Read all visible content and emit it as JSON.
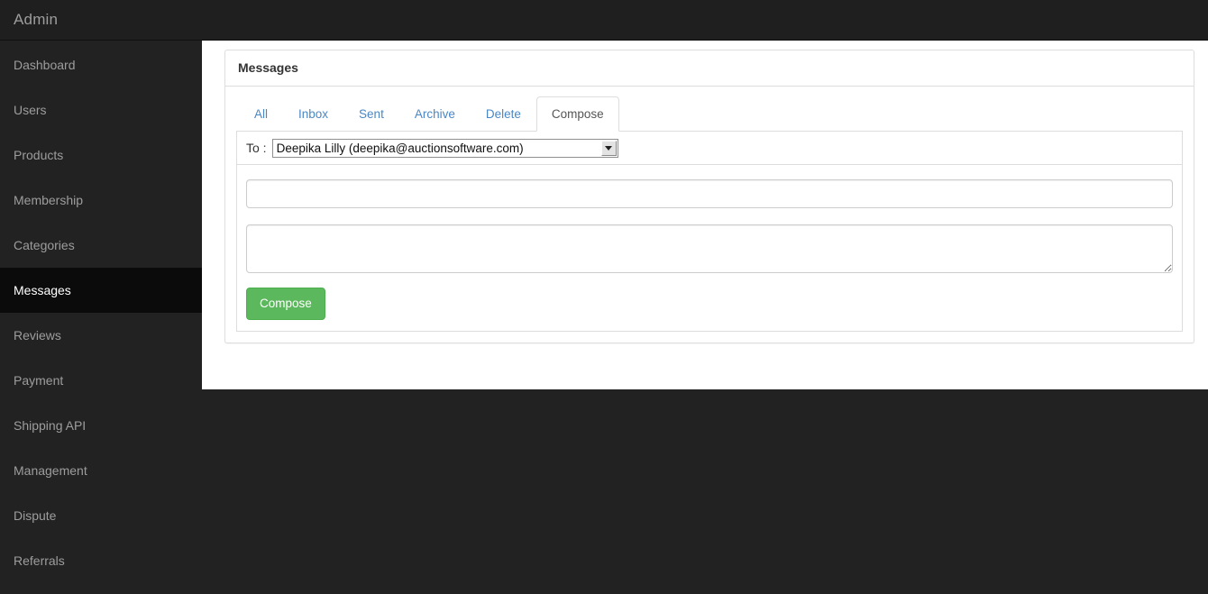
{
  "topbar": {
    "brand": "Admin"
  },
  "sidebar": {
    "items": [
      {
        "label": "Dashboard",
        "active": false
      },
      {
        "label": "Users",
        "active": false
      },
      {
        "label": "Products",
        "active": false
      },
      {
        "label": "Membership",
        "active": false
      },
      {
        "label": "Categories",
        "active": false
      },
      {
        "label": "Messages",
        "active": true
      },
      {
        "label": "Reviews",
        "active": false
      },
      {
        "label": "Payment",
        "active": false
      },
      {
        "label": "Shipping API",
        "active": false
      },
      {
        "label": "Management",
        "active": false
      },
      {
        "label": "Dispute",
        "active": false
      },
      {
        "label": "Referrals",
        "active": false
      }
    ]
  },
  "panel": {
    "title": "Messages"
  },
  "tabs": [
    {
      "label": "All",
      "active": false
    },
    {
      "label": "Inbox",
      "active": false
    },
    {
      "label": "Sent",
      "active": false
    },
    {
      "label": "Archive",
      "active": false
    },
    {
      "label": "Delete",
      "active": false
    },
    {
      "label": "Compose",
      "active": true
    }
  ],
  "compose_form": {
    "to_label": "To :",
    "recipient_selected": "Deepika Lilly (deepika@auctionsoftware.com)",
    "recipient_options": [
      "Deepika Lilly (deepika@auctionsoftware.com)"
    ],
    "subject_value": "",
    "subject_placeholder": "",
    "message_value": "",
    "message_placeholder": "",
    "submit_label": "Compose"
  },
  "colors": {
    "sidebar_bg": "#222222",
    "sidebar_active_bg": "#0b0b0b",
    "topbar_bg": "#1f1f1f",
    "link_blue": "#4a87c4",
    "success_green": "#5cb85c",
    "panel_border": "#dddddd"
  }
}
